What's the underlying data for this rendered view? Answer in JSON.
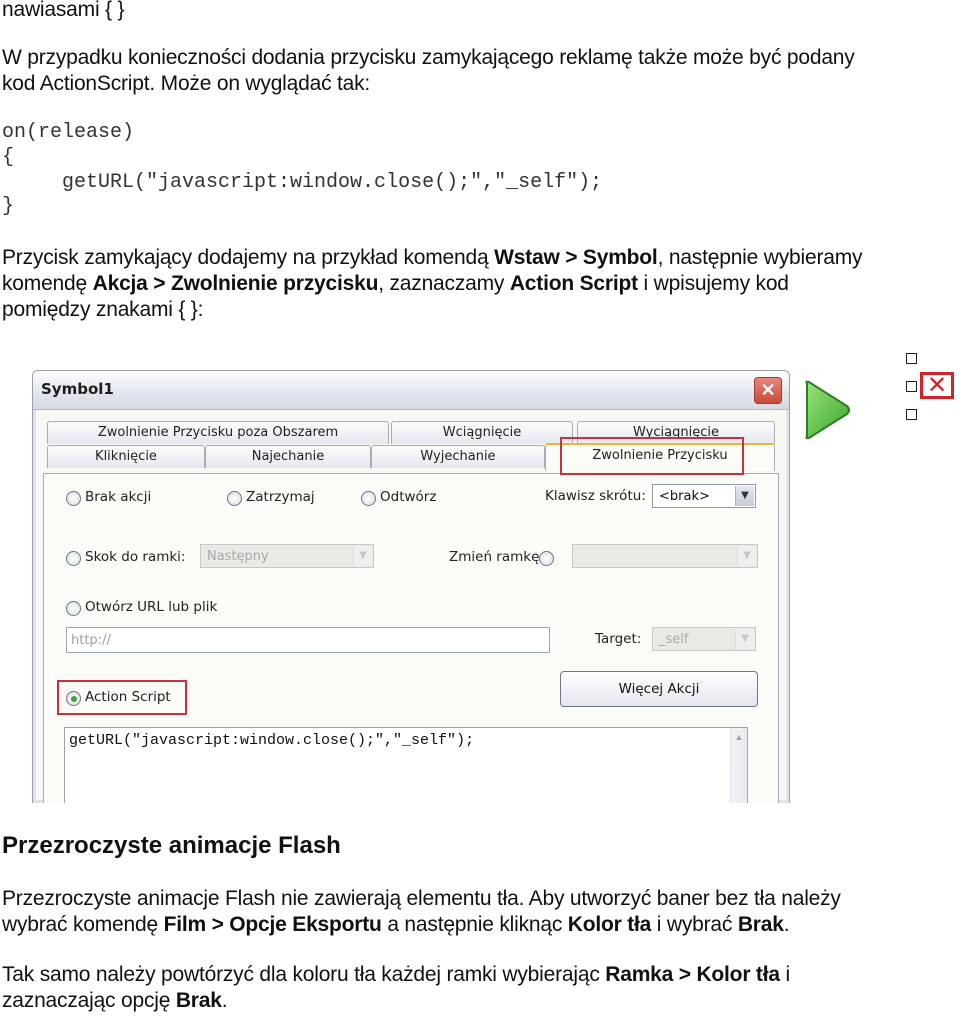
{
  "document": {
    "line_top": "nawiasami { }",
    "para1": {
      "line1": "W przypadku konieczności dodania przycisku zamykającego reklamę także może być podany",
      "line2": "kod ActionScript. Może on wyglądać tak:"
    },
    "code_block": [
      "on(release)",
      "{",
      "     getURL(\"javascript:window.close();\",\"_self\");",
      "}"
    ],
    "para2": {
      "l1_a": "Przycisk zamykający dodajemy na przykład komendą ",
      "l1_b": "Wstaw > Symbol",
      "l1_c": ", następnie wybieramy",
      "l2_a": "komendę ",
      "l2_b": "Akcja > Zwolnienie przycisku",
      "l2_c": ", zaznaczamy ",
      "l2_d": "Action Script",
      "l2_e": " i wpisujemy kod",
      "l3": "pomiędzy znakami { }:"
    },
    "heading": "Przezroczyste animacje Flash",
    "para3": {
      "l1": "Przezroczyste animacje Flash nie zawierają elementu tła. Aby utworzyć baner bez tła należy",
      "l2_a": "wybrać komendę ",
      "l2_b": "Film > Opcje Eksportu",
      "l2_c": " a następnie kliknąc ",
      "l2_d": "Kolor tła",
      "l2_e": " i wybrać ",
      "l2_f": "Brak",
      "l2_g": "."
    },
    "para4": {
      "l1_a": "Tak samo należy powtórzyć dla koloru tła każdej ramki wybierając ",
      "l1_b": "Ramka > Kolor tła",
      "l1_c": " i",
      "l2_a": "zaznaczając opcję ",
      "l2_b": "Brak",
      "l2_c": "."
    }
  },
  "dialog": {
    "title": "Symbol1",
    "close_glyph": "✕",
    "tabs_row1": [
      "Zwolnienie Przycisku poza Obszarem",
      "Wciągnięcie",
      "Wyciągnięcie"
    ],
    "tabs_row2": [
      "Kliknięcie",
      "Najechanie",
      "Wyjechanie",
      "Zwolnienie Przycisku"
    ],
    "active_tab": "Zwolnienie Przycisku",
    "options": {
      "brak_akcji": "Brak akcji",
      "zatrzymaj": "Zatrzymaj",
      "odtworz": "Odtwórz",
      "skok_do_ramki": "Skok do ramki:",
      "zmien_ramke": "Zmień ramkę:",
      "otworz_url": "Otwórz URL lub plik",
      "action_script": "Action Script"
    },
    "selected_option": "Action Script",
    "shortcut_label": "Klawisz skrótu:",
    "shortcut_value": "<brak>",
    "frame_select_value": "Następny",
    "frame_change_value": "",
    "url_placeholder": "http://",
    "target_label": "Target:",
    "target_value": "_self",
    "more_actions_button": "Więcej Akcji",
    "script_text": "getURL(\"javascript:window.close();\",\"_self\");",
    "dropdown_arrow": "▼",
    "scroll_up": "▲"
  },
  "side_icons": {
    "play": "play-icon",
    "close_x": "✕"
  }
}
